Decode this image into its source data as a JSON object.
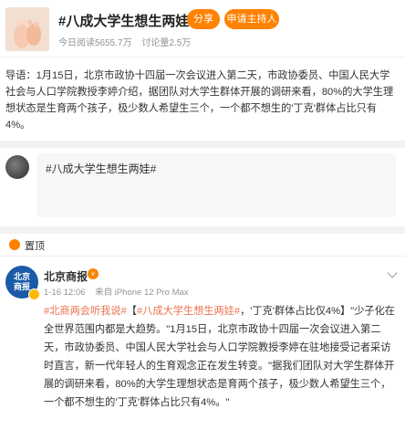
{
  "topic": {
    "title": "#八成大学生想生两娃#",
    "share_label": "分享",
    "apply_label": "申请主持人",
    "reads": "今日阅读5655.7万",
    "discussions": "讨论量2.5万"
  },
  "intro": "导语：1月15日，北京市政协十四届一次会议进入第二天，市政协委员、中国人民大学社会与人口学院教授李婷介绍，据团队对大学生群体开展的调研来看，80%的大学生理想状态是生育两个孩子，极少数人希望生三个，一个都不想生的'丁克'群体占比只有4%。",
  "compose": {
    "text": "#八成大学生想生两娃#"
  },
  "section_tab": {
    "label": "置顶"
  },
  "post": {
    "logo_line1": "北京",
    "logo_line2": "商报",
    "name": "北京商报",
    "vip_badge": "v",
    "time": "1-16 12:06",
    "device": "来自 iPhone 12 Pro Max",
    "tag1": "#北商两会听我说#",
    "tag2": "#八成大学生想生两娃#",
    "body": "，'丁克'群体占比仅4%】\"少子化在全世界范围内都是大趋势。\"1月15日，北京市政协十四届一次会议进入第二天，市政协委员、中国人民大学社会与人口学院教授李婷在驻地接受记者采访时直言，新一代年轻人的生育观念正在发生转变。\"据我们团队对大学生群体开展的调研来看，80%的大学生理想状态是育两个孩子，极少数人希望生三个，一个都不想生的'丁克'群体占比只有4%。\""
  },
  "colors": {
    "accent": "#ff8200",
    "tag": "#eb7350",
    "muted": "#939393"
  }
}
